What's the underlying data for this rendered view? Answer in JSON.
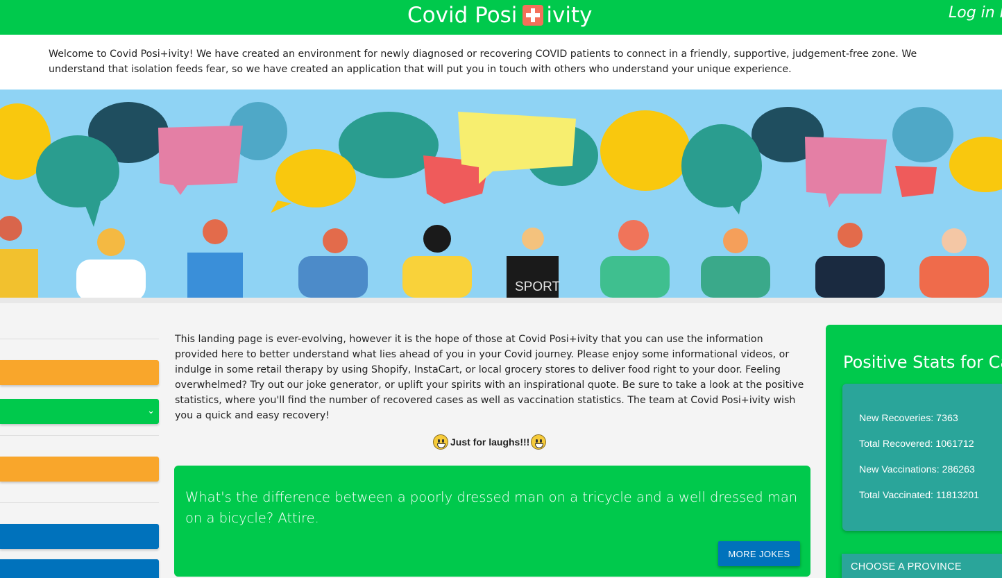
{
  "header": {
    "brand_left": "Covid Posi",
    "brand_right": "ivity",
    "login": "Log in P"
  },
  "welcome_text": "Welcome to Covid Posi+ivity! We have created an environment for newly diagnosed or recovering COVID patients to connect in a friendly, supportive, judgement-free zone. We understand that isolation feeds fear, so we have created an application that will put you in touch with others who understand your unique experience.",
  "hero": {
    "shirt_text": "SPORT"
  },
  "intro_text": "This landing page is ever-evolving, however it is the hope of those at Covid Posi+ivity that you can use the information provided here to better understand what lies ahead of you in your Covid journey. Please enjoy some informational videos, or indulge in some retail therapy by using Shopify, InstaCart, or local grocery stores to deliver food right to your door. Feeling overwhelmed? Try out our joke generator, or uplift your spirits with an inspirational quote. Be sure to take a look at the positive statistics, where you'll find the number of recovered cases as well as vaccination statistics. The team at Covid Posi+ivity wish you a quick and easy recovery!",
  "laughs_label": "Just for laughs!!!",
  "joke": {
    "text": "What's the difference between a poorly dressed man on a tricycle and a well dressed man on a bicycle? Attire.",
    "button": "MORE JOKES"
  },
  "stats": {
    "title": "Positive Stats for Cana",
    "items": [
      "New Recoveries: 7363",
      "Total Recovered: 1061712",
      "New Vaccinations: 286263",
      "Total Vaccinated: 11813201"
    ],
    "province_button": "CHOOSE A PROVINCE"
  },
  "colors": {
    "brand_green": "#00c94c",
    "teal": "#2aa59a",
    "orange": "#f9a62b",
    "blue": "#0072bc"
  },
  "icons": [
    "plus-cross-icon",
    "grinning-face-emoji-icon",
    "chevron-down-icon"
  ]
}
